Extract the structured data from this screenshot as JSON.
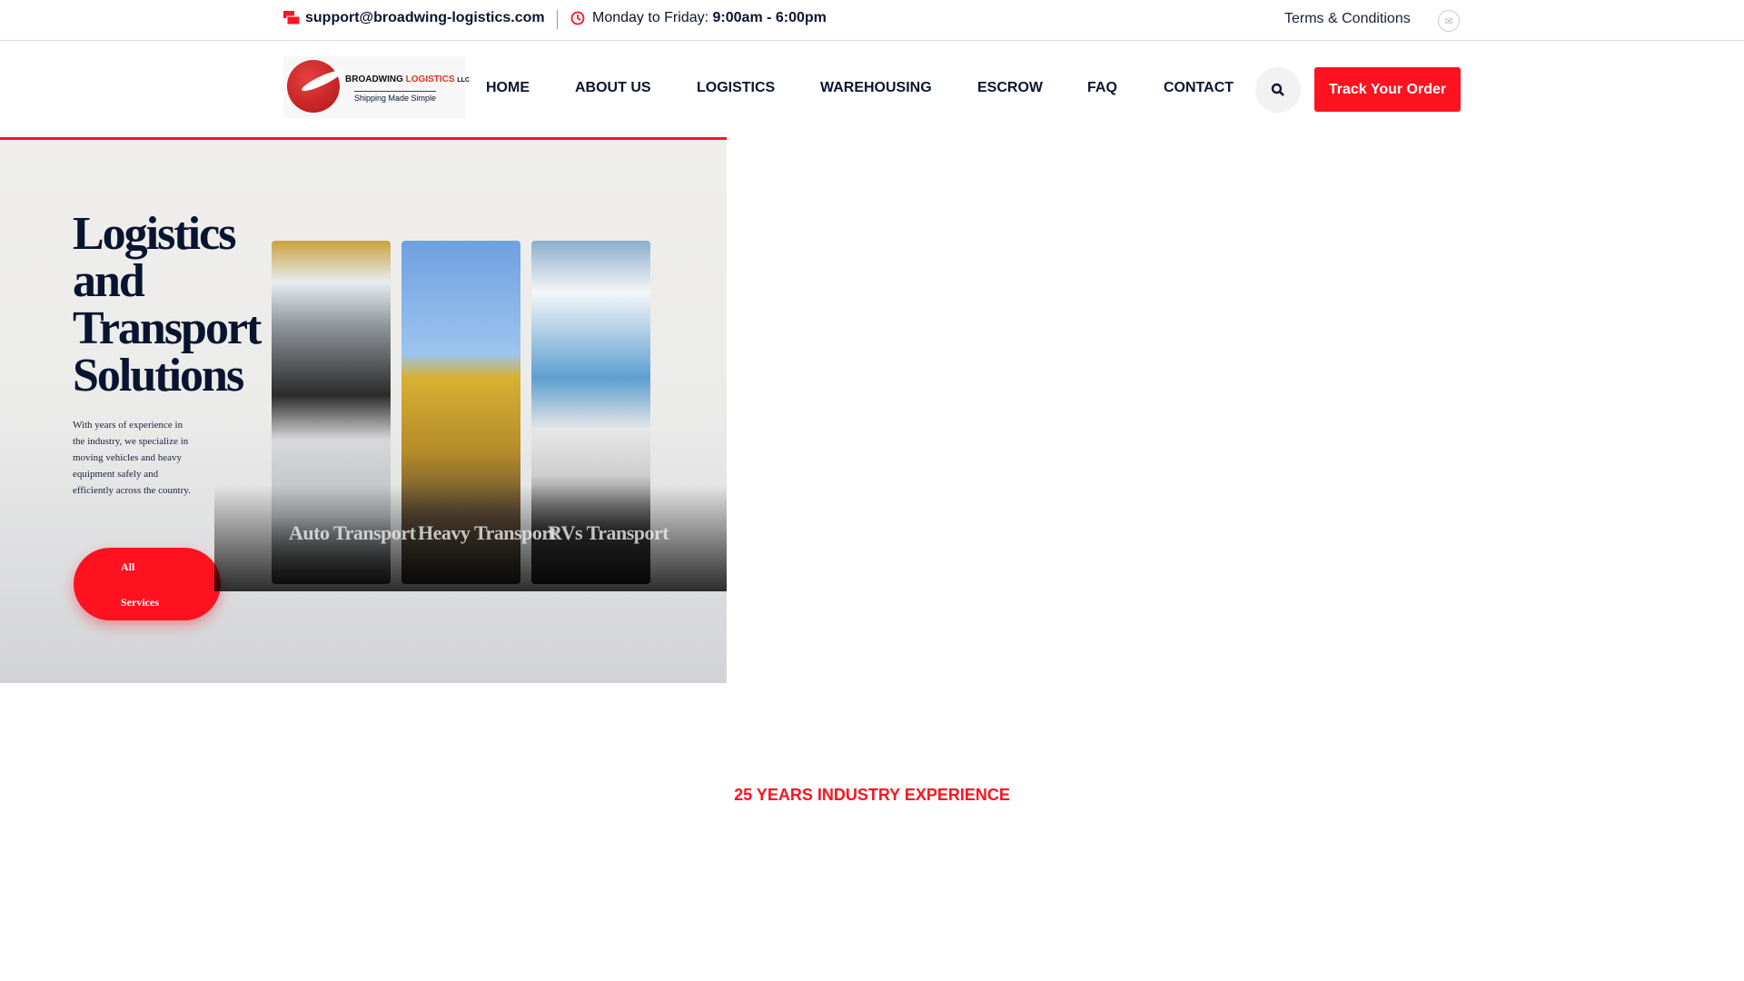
{
  "topbar": {
    "email": "support@broadwing-logistics.com",
    "hours_label": "Monday to Friday:",
    "hours_value": "9:00am - 6:00pm",
    "terms": "Terms & Conditions"
  },
  "logo": {
    "name": "BROADWING",
    "name_accent": "LOGISTICS",
    "suffix": "LLC",
    "tagline": "Shipping Made Simple"
  },
  "nav": {
    "items": [
      "HOME",
      "ABOUT US",
      "LOGISTICS",
      "WAREHOUSING",
      "ESCROW",
      "FAQ",
      "CONTACT"
    ],
    "track_label": "Track Your Order"
  },
  "hero": {
    "title_lines": [
      "Logistics",
      "and",
      "Transport",
      "Solutions"
    ],
    "description": "With years of experience in the industry, we specialize in moving vehicles and heavy equipment safely and efficiently across the country.",
    "button_line1": "All",
    "button_line2": "Services",
    "cards": [
      "Auto Transport",
      "Heavy Transport",
      "RVs Transport"
    ]
  },
  "experience": "25 YEARS INDUSTRY EXPERIENCE",
  "colors": {
    "accent": "#ff121f",
    "navy": "#0b1530"
  }
}
